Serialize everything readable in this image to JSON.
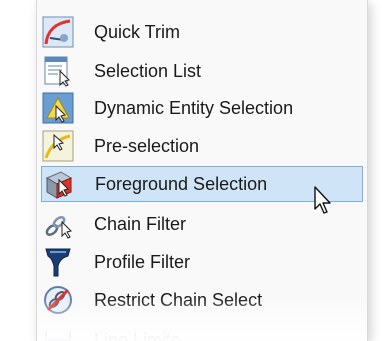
{
  "menu": {
    "items": [
      {
        "label": "Quick Trim",
        "icon": "quick-trim-icon"
      },
      {
        "label": "Selection List",
        "icon": "selection-list-icon"
      },
      {
        "label": "Dynamic Entity Selection",
        "icon": "dynamic-entity-selection-icon"
      },
      {
        "label": "Pre-selection",
        "icon": "pre-selection-icon"
      },
      {
        "label": "Foreground Selection",
        "icon": "foreground-selection-icon",
        "highlighted": true
      },
      {
        "label": "Chain Filter",
        "icon": "chain-filter-icon"
      },
      {
        "label": "Profile Filter",
        "icon": "profile-filter-icon"
      },
      {
        "label": "Restrict Chain Select",
        "icon": "restrict-chain-select-icon"
      },
      {
        "label": "Line Limits",
        "icon": "line-limits-icon",
        "faded": true
      }
    ]
  },
  "colors": {
    "highlight_background": "#cfe4f6",
    "highlight_border": "#7fb0db",
    "menu_background": "#f9f9f9"
  }
}
